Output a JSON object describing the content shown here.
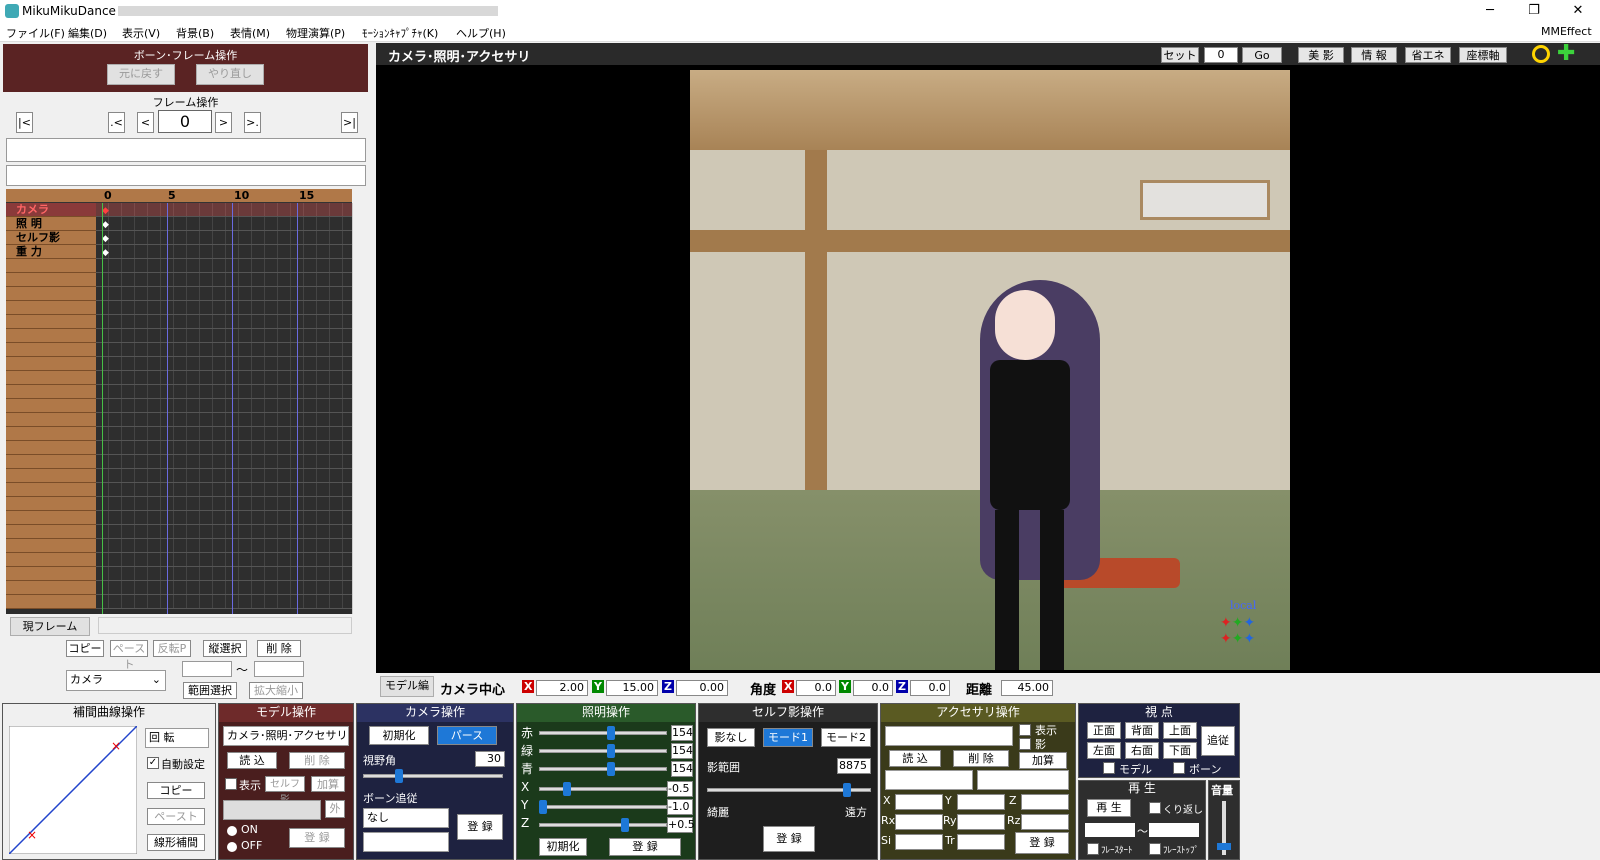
{
  "window": {
    "title": "MikuMikuDance",
    "min": "─",
    "restore": "❐",
    "close": "✕"
  },
  "menu": [
    "ファイル(F)",
    "編集(D)",
    "表示(V)",
    "背景(B)",
    "表情(M)",
    "物理演算(P)",
    "ﾓｰｼｮﾝｷｬﾌﾟﾁｬ(K)",
    "ヘルプ(H)"
  ],
  "mmeffect": "MMEffect",
  "bone_frame": {
    "title": "ボーン･フレーム操作",
    "undo": "元に戻す",
    "redo": "やり直し"
  },
  "frame_ops": {
    "title": "フレーム操作",
    "first": "|<",
    "prev_key": ".<",
    "prev": "<",
    "frame": "0",
    "next": ">",
    "next_key": ">.",
    "last": ">|"
  },
  "timeline": {
    "ticks": [
      "0",
      "5",
      "10",
      "15"
    ],
    "rows": [
      "カメラ",
      "照 明",
      "セルフ影",
      "重 力"
    ],
    "current_frame_btn": "現フレーム"
  },
  "edit_btns": {
    "copy": "コピー",
    "paste": "ペースト",
    "flip": "反転P",
    "vselect": "縦選択",
    "delete": "削 除",
    "range": "範囲選択",
    "scale": "拡大縮小",
    "tilde": "～"
  },
  "model_select": "カメラ",
  "viewport": {
    "title": "カメラ･照明･アクセサリ",
    "set": "セット",
    "frame": "0",
    "go": "Go",
    "beauty": "美 影",
    "info": "情 報",
    "eco": "省エネ",
    "axis": "座標軸",
    "local": "local"
  },
  "coords": {
    "model_edit": "モデル編",
    "camera_center": "カメラ中心",
    "x": "2.00",
    "y": "15.00",
    "z": "0.00",
    "angle": "角度",
    "ax": "0.0",
    "ay": "0.0",
    "az": "0.0",
    "dist_label": "距離",
    "dist": "45.00",
    "X": "X",
    "Y": "Y",
    "Z": "Z"
  },
  "interp": {
    "title": "補間曲線操作",
    "rotate": "回 転",
    "auto": "自動設定",
    "copy": "コピー",
    "paste": "ペースト",
    "linear": "線形補間"
  },
  "model_op": {
    "title": "モデル操作",
    "select": "カメラ･照明･アクセサリ",
    "load": "読 込",
    "delete": "削 除",
    "show": "表示",
    "self_shadow": "セルフ影",
    "add": "加算",
    "out": "外",
    "on": "ON",
    "off": "OFF",
    "register": "登 録"
  },
  "camera_op": {
    "title": "カメラ操作",
    "init": "初期化",
    "perspective": "パース",
    "fov_label": "視野角",
    "fov": "30",
    "follow_label": "ボーン追従",
    "follow": "なし",
    "register": "登 録"
  },
  "light_op": {
    "title": "照明操作",
    "r_label": "赤",
    "g_label": "緑",
    "b_label": "青",
    "r": "154",
    "g": "154",
    "b": "154",
    "x": "-0.5",
    "y": "-1.0",
    "z": "+0.5",
    "init": "初期化",
    "register": "登 録"
  },
  "shadow_op": {
    "title": "セルフ影操作",
    "none": "影なし",
    "mode1": "モード1",
    "mode2": "モード2",
    "range_label": "影範囲",
    "range": "8875",
    "near": "綺麗",
    "far": "遠方",
    "register": "登 録"
  },
  "acc_op": {
    "title": "アクセサリ操作",
    "show": "表示",
    "shadow": "影",
    "load": "読 込",
    "delete": "削 除",
    "add": "加算",
    "x": "X",
    "y": "Y",
    "z": "Z",
    "rx": "Rx",
    "ry": "Ry",
    "rz": "Rz",
    "si": "Si",
    "tr": "Tr",
    "register": "登 録"
  },
  "view_op": {
    "title": "視 点",
    "front": "正面",
    "back": "背面",
    "top": "上面",
    "left": "左面",
    "right": "右面",
    "bottom": "下面",
    "follow": "追従",
    "model": "モデル",
    "bone": "ボーン"
  },
  "play_op": {
    "title": "再 生",
    "play": "再 生",
    "loop": "くり返し",
    "tilde": "～",
    "start": "ﾌﾚｰｽﾀｰﾄ",
    "stop": "ﾌﾚｰｽﾄｯﾌﾟ",
    "volume": "音量"
  }
}
